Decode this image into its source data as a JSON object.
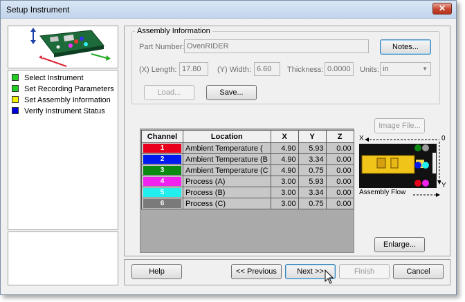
{
  "window": {
    "title": "Setup Instrument",
    "close_label": "✕"
  },
  "steps": [
    {
      "label": "Select Instrument",
      "color": "#22cc22"
    },
    {
      "label": "Set Recording Parameters",
      "color": "#22cc22"
    },
    {
      "label": "Set Assembly Information",
      "color": "#f0f000"
    },
    {
      "label": "Verify Instrument Status",
      "color": "#0000dd"
    }
  ],
  "assembly": {
    "group_title": "Assembly Information",
    "part_number_label": "Part Number:",
    "part_number_value": "OvenRIDER",
    "notes_label": "Notes...",
    "length_label": "(X) Length:",
    "length_value": "17.80",
    "width_label": "(Y) Width:",
    "width_value": "6.60",
    "thickness_label": "Thickness:",
    "thickness_value": "0.0000",
    "units_label": "Units:",
    "units_value": "in",
    "load_label": "Load...",
    "save_label": "Save..."
  },
  "channels_table": {
    "headers": [
      "Channel",
      "Location",
      "X",
      "Y",
      "Z"
    ],
    "rows": [
      {
        "channel": "1",
        "color": "#e8001c",
        "location": "Ambient Temperature (",
        "x": "4.90",
        "y": "5.93",
        "z": "0.00"
      },
      {
        "channel": "2",
        "color": "#0019ee",
        "location": "Ambient Temperature (B",
        "x": "4.90",
        "y": "3.34",
        "z": "0.00"
      },
      {
        "channel": "3",
        "color": "#0a8a12",
        "location": "Ambient Temperature (C",
        "x": "4.90",
        "y": "0.75",
        "z": "0.00"
      },
      {
        "channel": "4",
        "color": "#f022f0",
        "location": "Process (A)",
        "x": "3.00",
        "y": "5.93",
        "z": "0.00"
      },
      {
        "channel": "5",
        "color": "#22eeee",
        "location": "Process (B)",
        "x": "3.00",
        "y": "3.34",
        "z": "0.00"
      },
      {
        "channel": "6",
        "color": "#7a7a7a",
        "location": "Process (C)",
        "x": "3.00",
        "y": "0.75",
        "z": "0.00"
      }
    ]
  },
  "preview": {
    "image_file_label": "Image File...",
    "axis_x": "X",
    "axis_y": "Y",
    "axis_origin": "0",
    "flow_label": "Assembly Flow",
    "enlarge_label": "Enlarge..."
  },
  "footer": {
    "help_label": "Help",
    "previous_label": "<< Previous",
    "next_label": "Next >>",
    "finish_label": "Finish",
    "cancel_label": "Cancel"
  }
}
